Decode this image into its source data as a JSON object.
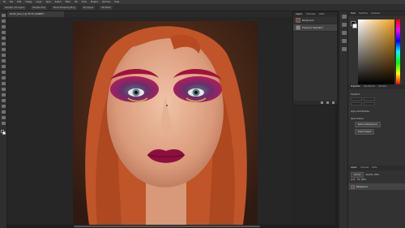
{
  "menu": [
    "Ps",
    "File",
    "Edit",
    "Image",
    "Layer",
    "Type",
    "Select",
    "Filter",
    "3D",
    "View",
    "Plugins",
    "Window",
    "Help"
  ],
  "options": [
    "Sample: All Layers",
    "Sample Size",
    "Show Sampling Ring",
    "All Layers",
    "3D Mode"
  ],
  "document_tab": "studio_face_1 @ 33.3% (RGB/8*)",
  "layers_panel": {
    "tabs": [
      "Layers",
      "Channels",
      "Paths"
    ],
    "active_tab": "Layers",
    "layers": [
      {
        "name": "Background"
      },
      {
        "name": "Frequency Separation"
      }
    ]
  },
  "right_panel": {
    "color_tabs": [
      "Color",
      "Swatches",
      "Gradients"
    ],
    "properties_tabs": [
      "Properties",
      "Adjustments",
      "Libraries"
    ],
    "properties": {
      "section1": "Transform",
      "section2": "Quick Actions",
      "buttons": [
        "Remove Background",
        "Select Subject"
      ],
      "align": "Align and Distribute"
    },
    "layers_tabs": [
      "Layers",
      "Channels",
      "Paths"
    ],
    "blend": "Normal",
    "opacity_label": "Opacity: 100%",
    "fill_label": "Fill: 100%",
    "lock_label": "Lock:",
    "layer_name": "Background"
  },
  "colors": {
    "accent": "#f2a11a",
    "ui_dark": "#252525",
    "panel": "#323232"
  }
}
